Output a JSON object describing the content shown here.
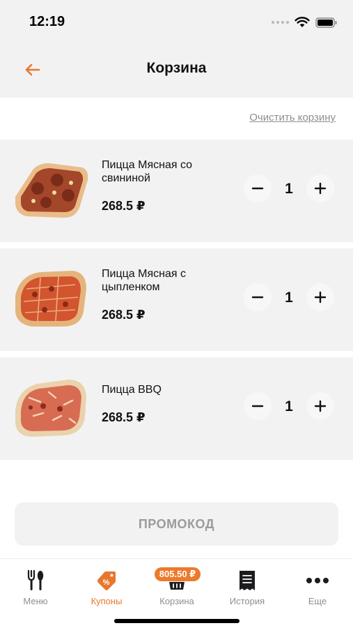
{
  "status_bar": {
    "time": "12:19"
  },
  "header": {
    "title": "Корзина"
  },
  "cart": {
    "clear_label": "Очистить корзину",
    "items": [
      {
        "name": "Пицца Мясная со свининой",
        "price": "268.5 ₽",
        "quantity": "1"
      },
      {
        "name": "Пицца Мясная с цыпленком",
        "price": "268.5 ₽",
        "quantity": "1"
      },
      {
        "name": "Пицца BBQ",
        "price": "268.5 ₽",
        "quantity": "1"
      }
    ]
  },
  "promo": {
    "label": "ПРОМОКОД"
  },
  "tabbar": {
    "cart_total_badge": "805.50 ₽",
    "tabs": [
      {
        "label": "Меню",
        "icon": "fork-knife-icon",
        "active": false
      },
      {
        "label": "Купоны",
        "icon": "coupon-tag-icon",
        "active": true
      },
      {
        "label": "Корзина",
        "icon": "basket-icon",
        "active": false
      },
      {
        "label": "История",
        "icon": "receipt-icon",
        "active": false
      },
      {
        "label": "Еще",
        "icon": "more-dots-icon",
        "active": false
      }
    ]
  },
  "colors": {
    "accent": "#e8772e",
    "inactive": "#8e8e93",
    "surface": "#f2f2f3"
  }
}
